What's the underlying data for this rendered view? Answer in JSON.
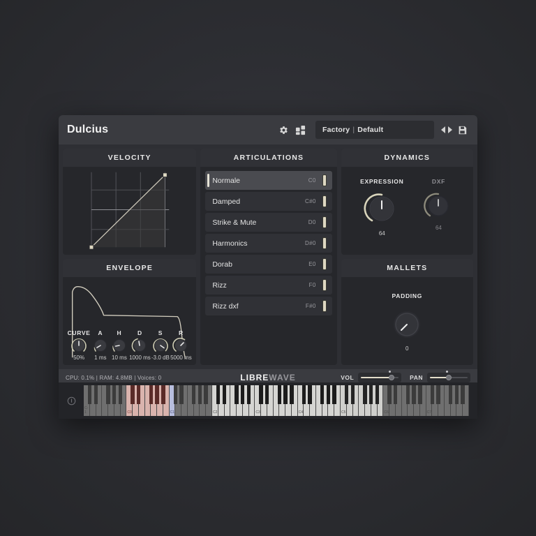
{
  "window": {
    "title": "Dulcius"
  },
  "header": {
    "icons": [
      "gear-icon",
      "grid-icon"
    ],
    "preset": {
      "bank": "Factory",
      "separator": "|",
      "name": "Default"
    },
    "nav": {
      "prev": "prev-preset",
      "next": "next-preset"
    },
    "save": "save-icon"
  },
  "panels": {
    "velocity": {
      "title": "VELOCITY"
    },
    "envelope": {
      "title": "ENVELOPE"
    },
    "articulations": {
      "title": "ARTICULATIONS"
    },
    "dynamics": {
      "title": "DYNAMICS"
    },
    "mallets": {
      "title": "MALLETS"
    }
  },
  "articulations": [
    {
      "name": "Normale",
      "key": "C0",
      "selected": true
    },
    {
      "name": "Damped",
      "key": "C#0",
      "selected": false
    },
    {
      "name": "Strike & Mute",
      "key": "D0",
      "selected": false
    },
    {
      "name": "Harmonics",
      "key": "D#0",
      "selected": false
    },
    {
      "name": "Dorab",
      "key": "E0",
      "selected": false
    },
    {
      "name": "Rizz",
      "key": "F0",
      "selected": false
    },
    {
      "name": "Rizz dxf",
      "key": "F#0",
      "selected": false
    }
  ],
  "envelope_knobs": [
    {
      "label": "CURVE",
      "value": "50%"
    },
    {
      "label": "A",
      "value": "1 ms"
    },
    {
      "label": "H",
      "value": "10 ms"
    },
    {
      "label": "D",
      "value": "1000 ms"
    },
    {
      "label": "S",
      "value": "-3.0 dB"
    },
    {
      "label": "R",
      "value": "5000 ms"
    }
  ],
  "dynamics_knobs": [
    {
      "label": "EXPRESSION",
      "value": "64",
      "dim": false
    },
    {
      "label": "DXF",
      "value": "64",
      "dim": true
    }
  ],
  "mallets_knob": {
    "label": "PADDING",
    "value": "0"
  },
  "statusbar": {
    "cpu": "CPU: 0.1%",
    "ram": "RAM: 4.8MB",
    "voices": "Voices: 0",
    "status_text": "CPU: 0.1% | RAM: 4.8MB | Voices: 0",
    "logo_first": "LIBRE",
    "logo_second": "WAVE",
    "vol_label": "VOL",
    "pan_label": "PAN"
  },
  "keyboard": {
    "info_icon": "info-icon",
    "labels": [
      "C-1",
      "C0",
      "C1",
      "C2",
      "C3",
      "C4",
      "C5",
      "C6",
      "C7"
    ]
  },
  "colors": {
    "accent_cream": "#e3ddca",
    "panel_bg": "#26272b",
    "panel_header": "#303136",
    "window_bg": "#2e2f34",
    "keyswitch_white": "#d9b3ad",
    "keyswitch_black": "#5a2b28",
    "key_highlight": "#b8bede",
    "text_primary": "#e8e8e8",
    "text_dim": "#8e8e93"
  }
}
